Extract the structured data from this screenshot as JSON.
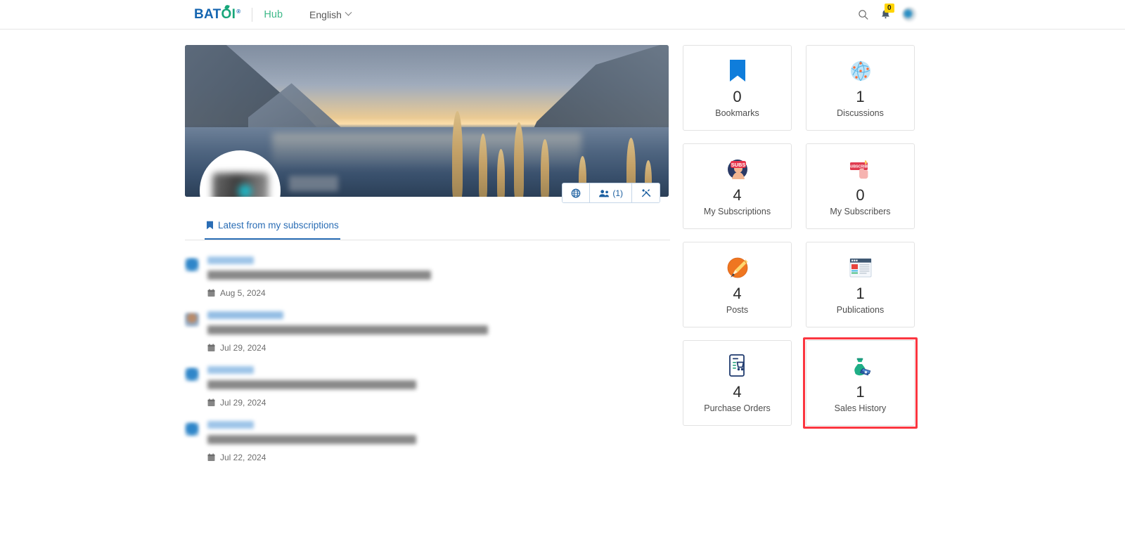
{
  "header": {
    "logo": {
      "part1": "BAT",
      "part2": "OI",
      "registered": "®",
      "name": "batoi-logo"
    },
    "hub_label": "Hub",
    "language": "English",
    "search_icon": "search-icon",
    "notification_icon": "bell-icon",
    "notification_count": "0",
    "avatar": "user-avatar"
  },
  "profile": {
    "cover_photo_alt": "lake-mountain-cover-photo",
    "avatar_alt": "profile-avatar",
    "name_redacted": "",
    "actions": [
      {
        "name": "website-button",
        "icon": "globe-icon",
        "label": ""
      },
      {
        "name": "members-button",
        "icon": "people-icon",
        "label": "(1)"
      },
      {
        "name": "tools-button",
        "icon": "tools-icon",
        "label": ""
      }
    ]
  },
  "tabs": [
    {
      "label": "Latest from my subscriptions",
      "icon": "bookmark-icon",
      "active": true
    }
  ],
  "feed": {
    "items": [
      {
        "author": "",
        "title": "",
        "date": "Aug 5, 2024",
        "avatar_type": "blue",
        "title_width": "ft-1",
        "author_width": ""
      },
      {
        "author": "",
        "title": "",
        "date": "Jul 29, 2024",
        "avatar_type": "person",
        "title_width": "ft-2",
        "author_width": "wide"
      },
      {
        "author": "",
        "title": "",
        "date": "Jul 29, 2024",
        "avatar_type": "blue",
        "title_width": "ft-3",
        "author_width": ""
      },
      {
        "author": "",
        "title": "",
        "date": "Jul 22, 2024",
        "avatar_type": "blue",
        "title_width": "ft-4",
        "author_width": ""
      }
    ],
    "date_icon": "calendar-icon"
  },
  "cards": [
    {
      "count": "0",
      "label": "Bookmarks",
      "icon": "bookmark-icon",
      "highlight": false
    },
    {
      "count": "1",
      "label": "Discussions",
      "icon": "network-globe-icon",
      "highlight": false
    },
    {
      "count": "4",
      "label": "My Subscriptions",
      "icon": "subscribe-badge-icon",
      "highlight": false
    },
    {
      "count": "0",
      "label": "My Subscribers",
      "icon": "subscribe-button-icon",
      "highlight": false
    },
    {
      "count": "4",
      "label": "Posts",
      "icon": "pen-nib-icon",
      "highlight": false
    },
    {
      "count": "1",
      "label": "Publications",
      "icon": "article-icon",
      "highlight": false
    },
    {
      "count": "4",
      "label": "Purchase Orders",
      "icon": "invoice-cart-icon",
      "highlight": false
    },
    {
      "count": "1",
      "label": "Sales History",
      "icon": "money-bag-icon",
      "highlight": true
    }
  ],
  "colors": {
    "brand_blue": "#1565b0",
    "brand_green": "#17a67a",
    "hub_green": "#3fb98a",
    "accent_link": "#2a6db5",
    "highlight_red": "#fb3640",
    "badge_yellow": "#ffd400"
  }
}
